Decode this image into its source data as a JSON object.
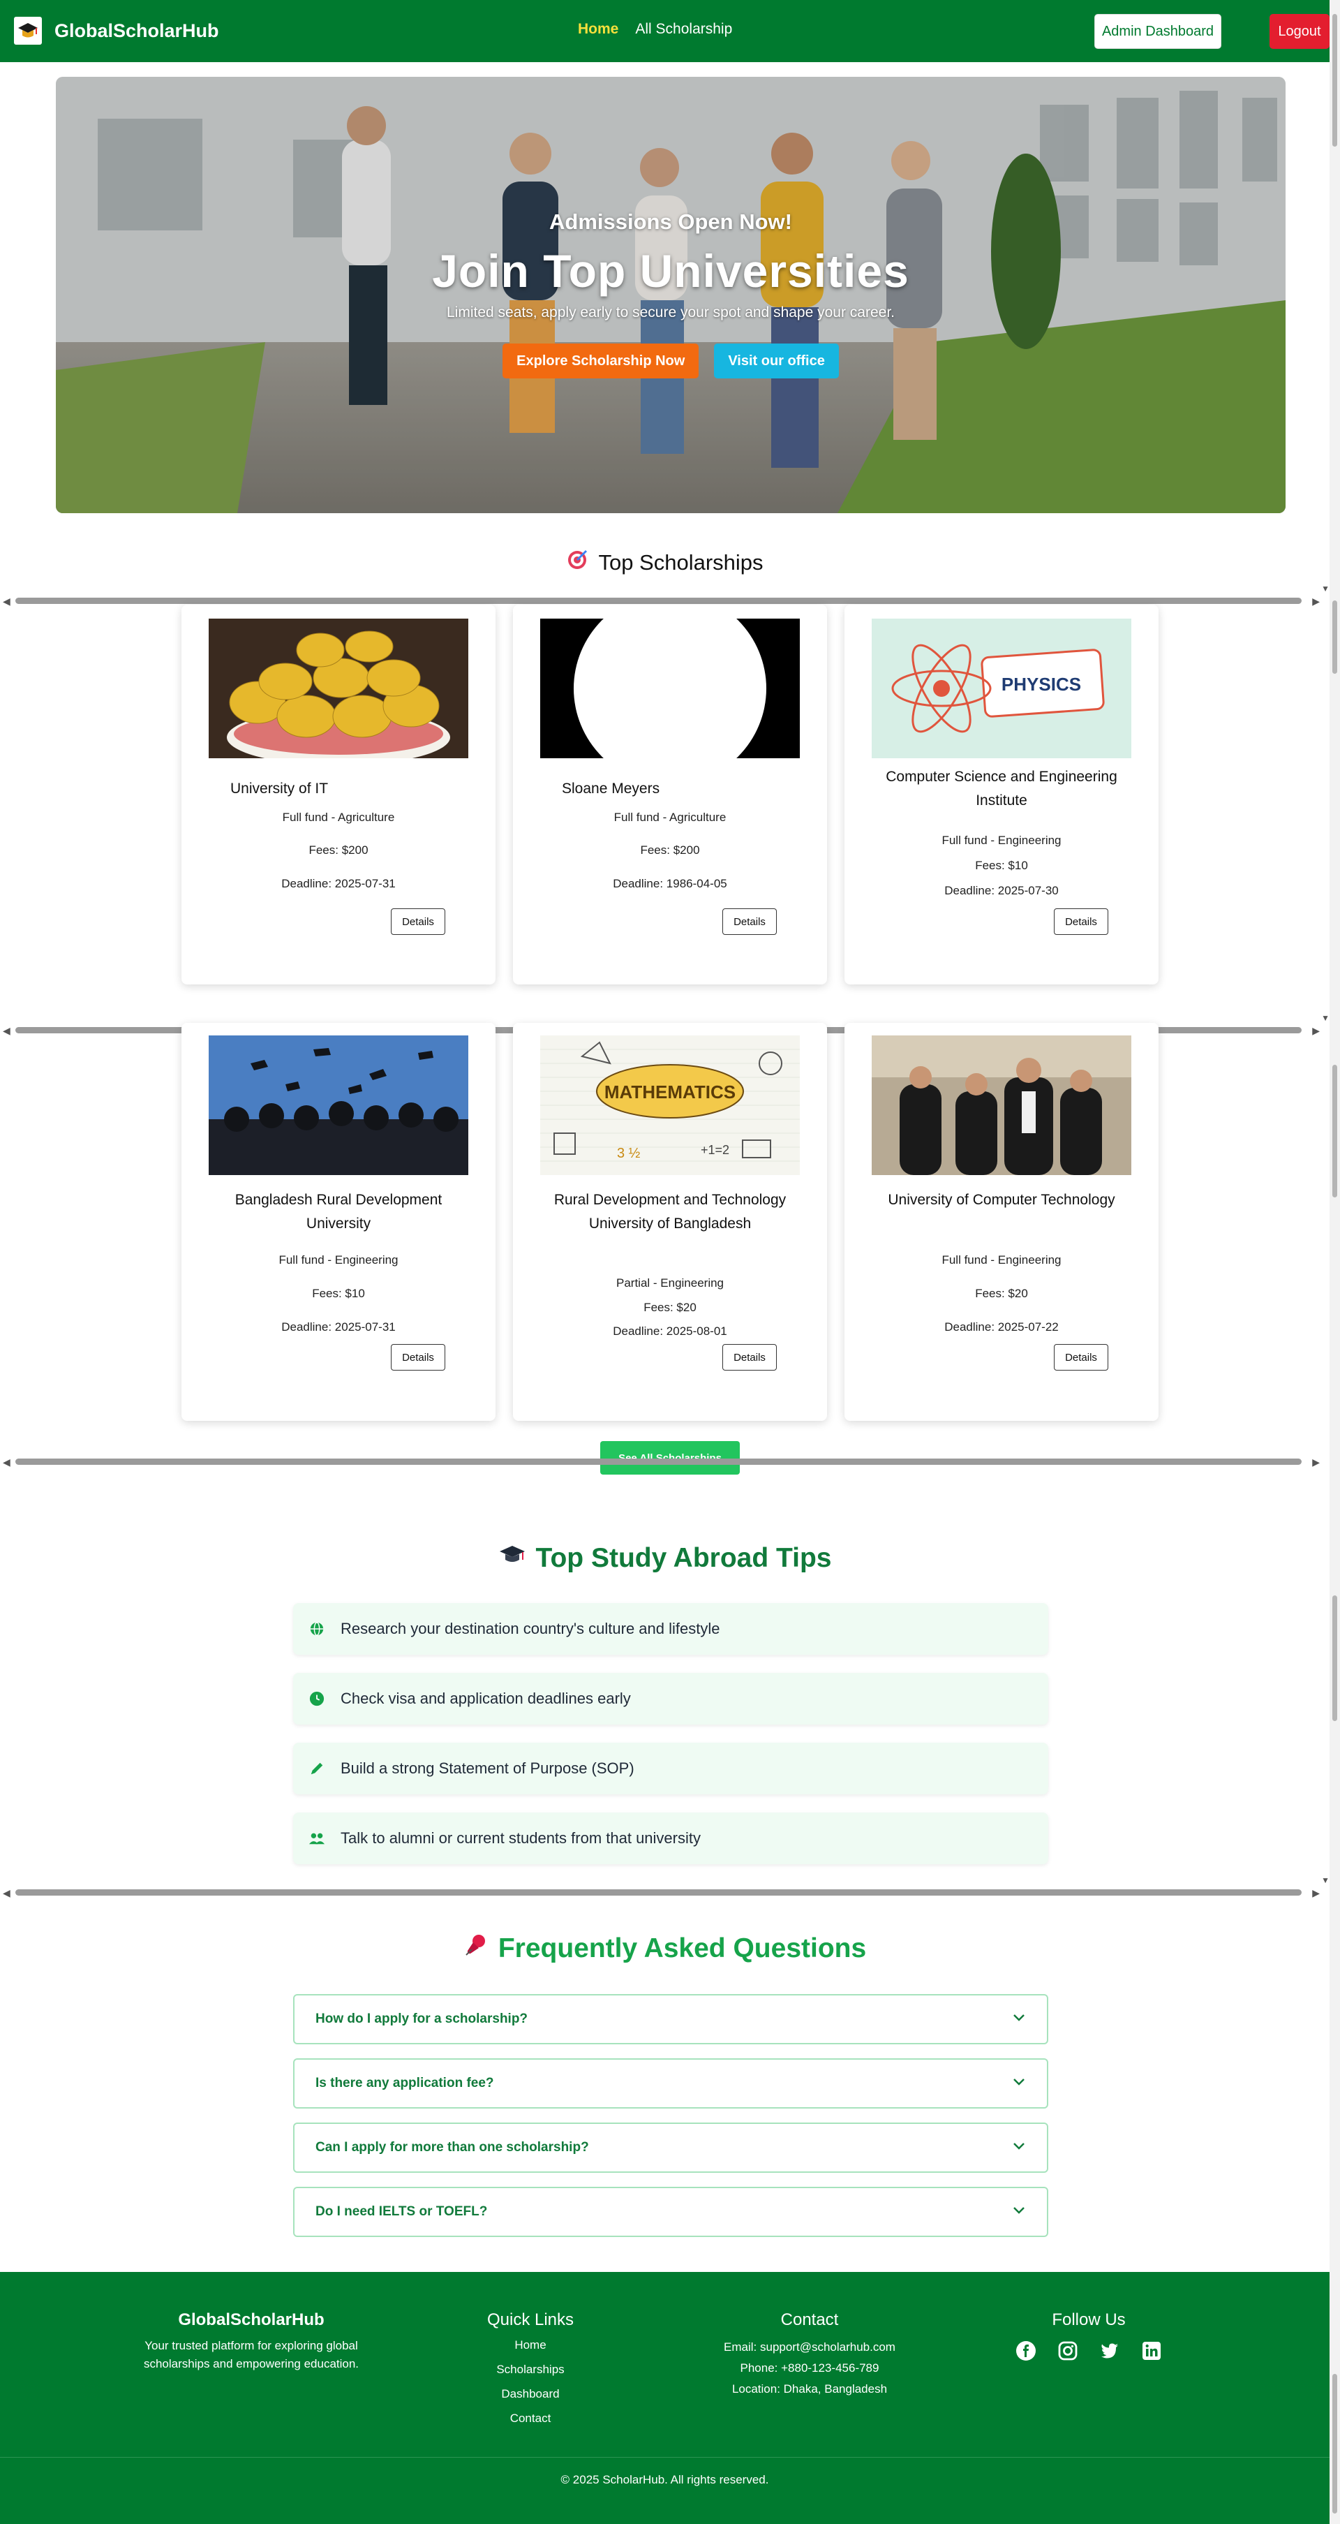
{
  "navbar": {
    "brand": "GlobalScholarHub",
    "links": [
      "Home",
      "All Scholarship"
    ],
    "admin_button": "Admin Dashboard",
    "logout_button": "Logout"
  },
  "hero": {
    "subtitle": "Admissions Open Now!",
    "title": "Join Top Universities",
    "description": "Limited seats, apply early to secure your spot and shape your career.",
    "explore_button": "Explore Scholarship Now",
    "visit_button": "Visit our office"
  },
  "scholarships": {
    "heading": "Top Scholarships",
    "heading_icon": "target-icon",
    "cards": [
      {
        "name": "University of IT",
        "category": "Full fund - Agriculture",
        "fees": "Fees: $200",
        "deadline": "Deadline: 2025-07-31",
        "button": "Details",
        "image": "lemons-bowl"
      },
      {
        "name": "Sloane Meyers",
        "category": "Full fund - Agriculture",
        "fees": "Fees: $200",
        "deadline": "Deadline: 1986-04-05",
        "button": "Details",
        "image": "black-circle"
      },
      {
        "name": "Computer Science and Engineering Institute",
        "category": "Full fund - Engineering",
        "fees": "Fees: $10",
        "deadline": "Deadline: 2025-07-30",
        "button": "Details",
        "image": "physics"
      },
      {
        "name": "Bangladesh Rural Development University",
        "category": "Full fund - Engineering",
        "fees": "Fees: $10",
        "deadline": "Deadline: 2025-07-31",
        "button": "Details",
        "image": "graduation-caps"
      },
      {
        "name": "Rural Development and Technology University of Bangladesh",
        "category": "Partial - Engineering",
        "fees": "Fees: $20",
        "deadline": "Deadline: 2025-08-01",
        "button": "Details",
        "image": "mathematics"
      },
      {
        "name": "University of Computer Technology",
        "category": "Full fund - Engineering",
        "fees": "Fees: $20",
        "deadline": "Deadline: 2025-07-22",
        "button": "Details",
        "image": "graduates"
      }
    ],
    "see_all_button": "See All Scholarships"
  },
  "tips": {
    "heading": "Top Study Abroad Tips",
    "items": [
      {
        "text": "Research your destination country's culture and lifestyle",
        "icon": "globe-icon"
      },
      {
        "text": "Check visa and application deadlines early",
        "icon": "clock-icon"
      },
      {
        "text": "Build a strong Statement of Purpose (SOP)",
        "icon": "pen-icon"
      },
      {
        "text": "Talk to alumni or current students from that university",
        "icon": "users-icon"
      }
    ]
  },
  "faq": {
    "heading": "Frequently Asked Questions",
    "items": [
      "How do I apply for a scholarship?",
      "Is there any application fee?",
      "Can I apply for more than one scholarship?",
      "Do I need IELTS or TOEFL?"
    ]
  },
  "footer": {
    "brand": "GlobalScholarHub",
    "tagline": "Your trusted platform for exploring global scholarships and empowering education.",
    "quick_links_title": "Quick Links",
    "quick_links": [
      "Home",
      "Scholarships",
      "Dashboard",
      "Contact"
    ],
    "contact_title": "Contact",
    "email": "Email: support@scholarhub.com",
    "phone": "Phone: +880-123-456-789",
    "location": "Location: Dhaka, Bangladesh",
    "follow_title": "Follow Us",
    "socials": [
      "facebook-icon",
      "instagram-icon",
      "twitter-icon",
      "linkedin-icon"
    ],
    "copyright": "© 2025 ScholarHub. All rights reserved."
  },
  "colors": {
    "primary_green": "#007a2f",
    "accent_yellow": "#f7e03c",
    "logout_red": "#e31e2f",
    "explore_orange": "#f26a10",
    "visit_cyan": "#17b6e0",
    "tip_bg": "#effbf3"
  }
}
